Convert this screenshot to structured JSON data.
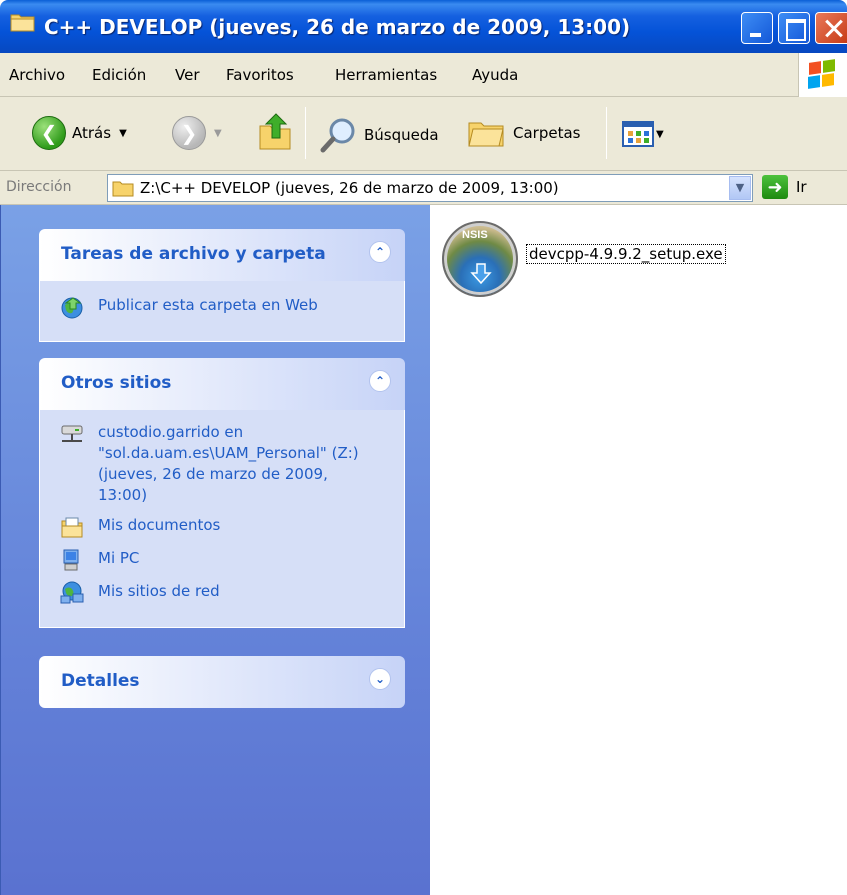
{
  "window": {
    "title": "C++ DEVELOP (jueves, 26 de marzo de 2009, 13:00)"
  },
  "menu": [
    "Archivo",
    "Edición",
    "Ver",
    "Favoritos",
    "Herramientas",
    "Ayuda"
  ],
  "toolbar": {
    "back_label": "Atrás",
    "search_label": "Búsqueda",
    "folders_label": "Carpetas"
  },
  "address": {
    "label": "Dirección",
    "value": "Z:\\C++ DEVELOP (jueves, 26 de marzo de 2009, 13:00)",
    "go_label": "Ir"
  },
  "tasks_panel": {
    "title": "Tareas de archivo y carpeta",
    "items": [
      {
        "label": "Publicar esta carpeta en Web",
        "icon": "globe-publish-icon"
      }
    ]
  },
  "places_panel": {
    "title": "Otros sitios",
    "items": [
      {
        "label": "custodio.garrido en \"sol.da.uam.es\\UAM_Personal\" (Z:) (jueves, 26 de marzo de 2009, 13:00)",
        "icon": "network-drive-icon"
      },
      {
        "label": "Mis documentos",
        "icon": "my-documents-icon"
      },
      {
        "label": "Mi PC",
        "icon": "my-computer-icon"
      },
      {
        "label": "Mis sitios de red",
        "icon": "network-places-icon"
      }
    ]
  },
  "details_panel": {
    "title": "Detalles"
  },
  "files": [
    {
      "name": "devcpp-4.9.9.2_setup.exe",
      "icon_text": "NSIS"
    }
  ]
}
